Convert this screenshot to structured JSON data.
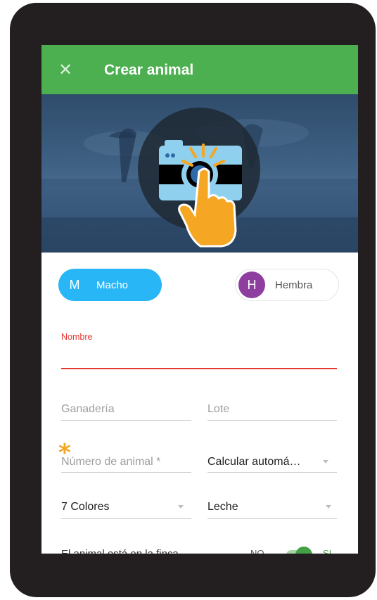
{
  "app_bar": {
    "close_icon": "close-icon",
    "title": "Crear animal",
    "color": "#4caf50"
  },
  "photo": {
    "camera_icon": "camera-icon",
    "hand_icon": "tap-hand-icon"
  },
  "sex": {
    "male": {
      "initial": "M",
      "label": "Macho",
      "color": "#29b6f6"
    },
    "female": {
      "initial": "H",
      "label": "Hembra",
      "color": "#8e3e9f"
    }
  },
  "form": {
    "nombre_label": "Nombre",
    "ganaderia_placeholder": "Ganadería",
    "lote_placeholder": "Lote",
    "numero_placeholder": "Número de animal *",
    "calcular_value": "Calcular automá…",
    "raza_value": "7 Colores",
    "tipo_value": "Leche",
    "row_label": "El animal está en la finca",
    "toggle_no": "NO",
    "toggle_si": "SI"
  },
  "accent": {
    "error": "#e53935",
    "highlight": "#f5a623"
  }
}
